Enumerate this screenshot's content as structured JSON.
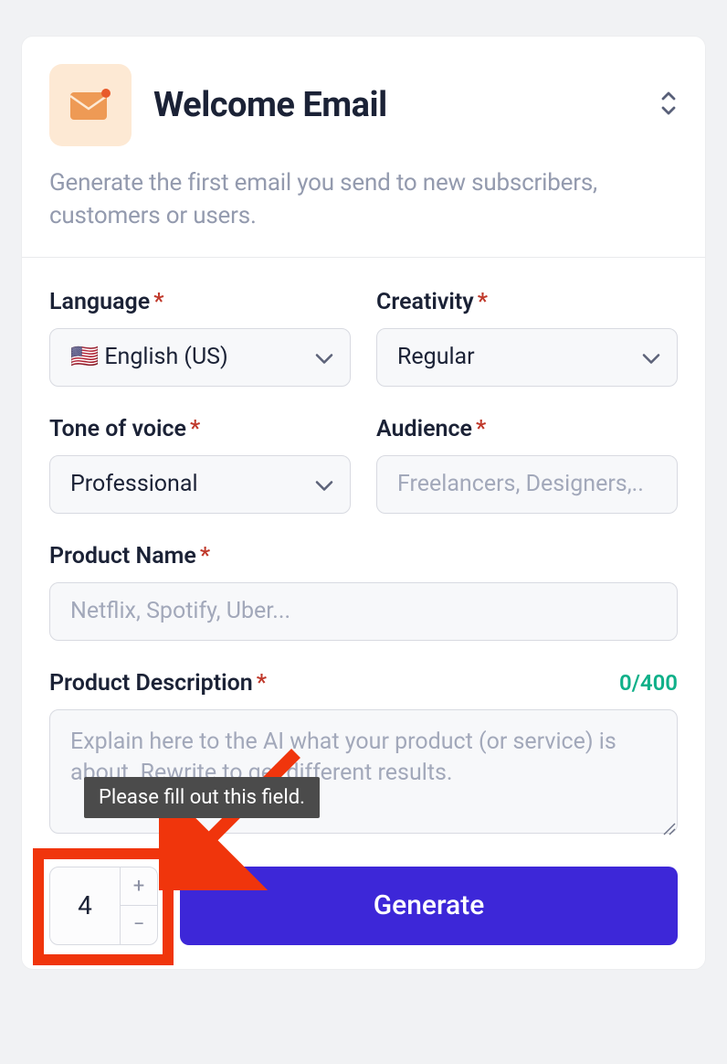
{
  "header": {
    "title": "Welcome Email",
    "description": "Generate the first email you send to new subscribers, customers or users."
  },
  "fields": {
    "language": {
      "label": "Language",
      "value": "🇺🇸 English (US)"
    },
    "creativity": {
      "label": "Creativity",
      "value": "Regular"
    },
    "tone": {
      "label": "Tone of voice",
      "value": "Professional"
    },
    "audience": {
      "label": "Audience",
      "placeholder": "Freelancers, Designers,.."
    },
    "product_name": {
      "label": "Product Name",
      "placeholder": "Netflix, Spotify, Uber..."
    },
    "product_description": {
      "label": "Product Description",
      "placeholder": "Explain here to the AI what your product (or service) is about. Rewrite to get different results.",
      "counter": "0/400"
    }
  },
  "tooltip": "Please fill out this field.",
  "stepper": {
    "value": "4"
  },
  "generate": {
    "label": "Generate"
  },
  "required_mark": "*"
}
